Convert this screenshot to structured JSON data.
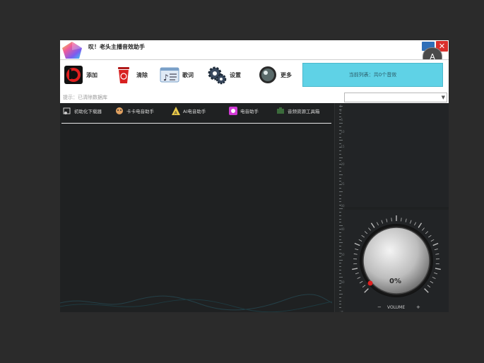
{
  "window": {
    "title": "叹！老头主播音效助手",
    "close_glyph": "✕",
    "float_glyph": "A"
  },
  "toolbar": {
    "add_label": "添加",
    "clear_label": "清除",
    "lyrics_label": "歌词",
    "settings_label": "设置",
    "more_label": "更多",
    "playlist_status": "当前列表：共0个音效"
  },
  "hint": {
    "text": "提示：已清除数据库",
    "select_value": "",
    "select_arrow": "▼"
  },
  "plugins": [
    {
      "label": "初助化下载器",
      "icon": "download-icon"
    },
    {
      "label": "卡卡电音助手",
      "icon": "face-icon"
    },
    {
      "label": "AI电音助手",
      "icon": "ai-icon"
    },
    {
      "label": "电音助手",
      "icon": "pink-disc-icon"
    },
    {
      "label": "音频资源工具箱",
      "icon": "toolbox-icon"
    }
  ],
  "ruler": {
    "labels": [
      "5",
      "0",
      "-5",
      "-10",
      "-15",
      "-20",
      "-25",
      "-30",
      "-40",
      "-50",
      "-60",
      "-∞"
    ]
  },
  "volume": {
    "value": "0%",
    "label": "VOLUME",
    "minus": "−",
    "plus": "+",
    "level": 0
  }
}
